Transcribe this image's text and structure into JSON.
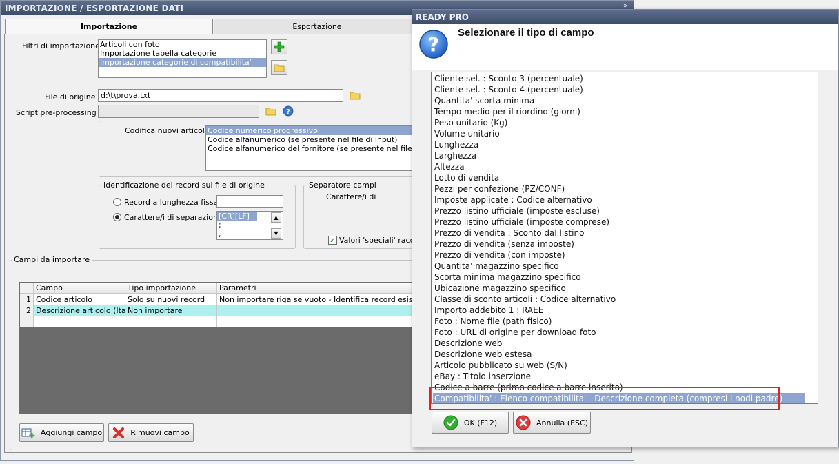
{
  "main": {
    "title": "IMPORTAZIONE / ESPORTAZIONE DATI",
    "collapse_glyph": "»",
    "tabs": [
      {
        "label": "Importazione",
        "active": true
      },
      {
        "label": "Esportazione",
        "active": false
      }
    ],
    "filters": {
      "label": "Filtri di importazione :",
      "items": [
        "Articoli con foto",
        "Importazione tabella categorie",
        "Importazione categorie di compatibilita'"
      ],
      "selected_index": 2
    },
    "source_file": {
      "label": "File di origine :",
      "value": "d:\\t\\prova.txt"
    },
    "script": {
      "label": "Script pre-processing :",
      "value": ""
    },
    "coding": {
      "label": "Codifica nuovi articoli :",
      "items": [
        "Codice numerico progressivo",
        "Codice alfanumerico (se presente nel file di input)",
        "Codice alfanumerico del fornitore (se presente nel file di input)"
      ],
      "selected_index": 0
    },
    "identification": {
      "title": "Identificazione dei record sul file di origine",
      "fixed_length_label": "Record a lunghezza fissa",
      "separator_label": "Carattere/i di separazione",
      "separator_items": [
        "[CR][LF]",
        ";",
        ","
      ],
      "selected": "separator"
    },
    "field_separator": {
      "title": "Separatore campi",
      "char_label": "Carattere/i di",
      "special_values_label": "Valori 'speciali' racchius",
      "special_checked": true
    },
    "fields_to_import": {
      "title": "Campi da importare",
      "columns": [
        "Campo",
        "Tipo importazione",
        "Parametri"
      ],
      "rows": [
        {
          "num": "1",
          "campo": "Codice articolo",
          "tipo": "Solo su nuovi record",
          "parametri": "Non importare riga se vuoto - Identifica record esistenti da"
        },
        {
          "num": "2",
          "campo": "Descrizione articolo (Ital...",
          "tipo": "Non importare",
          "parametri": ""
        }
      ]
    },
    "buttons": {
      "add": "Aggiungi campo",
      "remove": "Rimuovi campo"
    }
  },
  "dialog": {
    "title": "READY PRO",
    "heading": "Selezionare il tipo di campo",
    "options": [
      "Cliente sel. : Sconto 3 (percentuale)",
      "Cliente sel. : Sconto 4 (percentuale)",
      "Quantita' scorta minima",
      "Tempo medio per il riordino (giorni)",
      "Peso unitario (Kg)",
      "Volume unitario",
      "Lunghezza",
      "Larghezza",
      "Altezza",
      "Lotto di vendita",
      "Pezzi per confezione (PZ/CONF)",
      "Imposte applicate : Codice alternativo",
      "Prezzo listino ufficiale (imposte escluse)",
      "Prezzo listino ufficiale (imposte comprese)",
      "Prezzo di vendita : Sconto dal listino",
      "Prezzo di vendita (senza imposte)",
      "Prezzo di vendita (con imposte)",
      "Quantita' magazzino specifico",
      "Scorta minima magazzino specifico",
      "Ubicazione magazzino specifico",
      "Classe di sconto articoli : Codice alternativo",
      "Importo addebito 1 : RAEE",
      "Foto : Nome file (path fisico)",
      "Foto : URL di origine per download foto",
      "Descrizione web",
      "Descrizione web estesa",
      "Articolo pubblicato su web (S/N)",
      "eBay : Titolo inserzione",
      "Codice a barre (primo codice a barre inserito)",
      "Compatibilita' : Elenco compatibilita' - Descrizione completa (compresi i nodi padre)"
    ],
    "selected_index": 29,
    "ok_label": "OK (F12)",
    "cancel_label": "Annulla (ESC)"
  },
  "colors": {
    "selection": "#8ea5cf",
    "highlight": "#e02424",
    "titlebar": "#4a5a78"
  }
}
